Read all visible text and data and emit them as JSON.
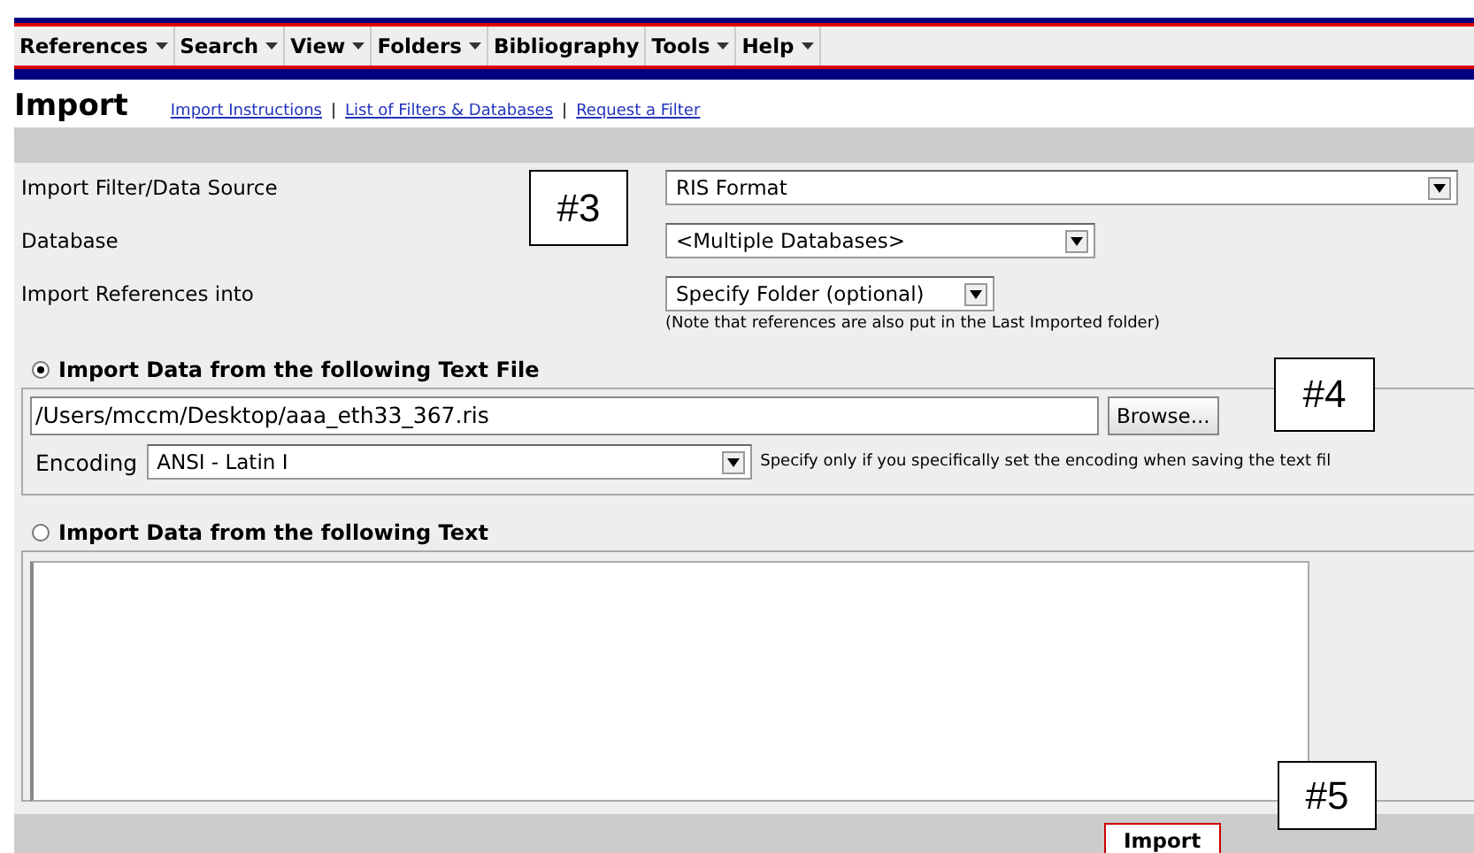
{
  "menu": [
    {
      "label": "References",
      "dropdown": true
    },
    {
      "label": "Search",
      "dropdown": true
    },
    {
      "label": "View",
      "dropdown": true
    },
    {
      "label": "Folders",
      "dropdown": true
    },
    {
      "label": "Bibliography",
      "dropdown": false
    },
    {
      "label": "Tools",
      "dropdown": true
    },
    {
      "label": "Help",
      "dropdown": true
    }
  ],
  "page_title": "Import",
  "links": [
    "Import Instructions",
    "List of Filters & Databases",
    "Request a Filter"
  ],
  "link_separators": [
    "|",
    "|"
  ],
  "form": [
    {
      "label": "Import Filter/Data Source",
      "value": "RIS Format"
    },
    {
      "label": "Database",
      "value": "<Multiple Databases>"
    },
    {
      "label": "Import References into",
      "value": "Specify Folder (optional)",
      "note": "(Note that references are also put in the Last Imported folder)"
    }
  ],
  "file_section": {
    "label": "Import Data from the following Text File",
    "selected": true,
    "file_path": "/Users/mccm/Desktop/aaa_eth33_367.ris",
    "browse_button": "Browse...",
    "encoding_label": "Encoding",
    "encoding_value": "ANSI - Latin I",
    "encoding_note": "Specify only if you specifically set the encoding when saving the text fil"
  },
  "text_section": {
    "label": "Import Data from the following Text",
    "selected": false
  },
  "import_button": "Import",
  "callouts": [
    "#3",
    "#4",
    "#5"
  ]
}
